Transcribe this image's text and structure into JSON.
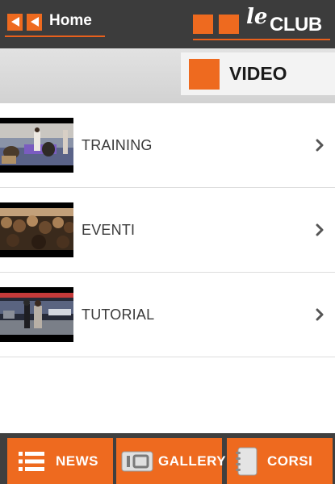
{
  "header": {
    "back_label": "Home",
    "back_icon": "double-left-arrow-icon",
    "logo_text_le": "le",
    "logo_text_club": "CLUB"
  },
  "section": {
    "title": "VIDEO"
  },
  "list": {
    "items": [
      {
        "label": "TRAINING",
        "thumbnail": "training-video-thumbnail"
      },
      {
        "label": "EVENTI",
        "thumbnail": "eventi-video-thumbnail"
      },
      {
        "label": "TUTORIAL",
        "thumbnail": "tutorial-video-thumbnail"
      }
    ]
  },
  "tabbar": {
    "tabs": [
      {
        "label": "NEWS",
        "icon": "list-icon"
      },
      {
        "label": "GALLERY",
        "icon": "camera-icon"
      },
      {
        "label": "CORSI",
        "icon": "notebook-icon"
      }
    ]
  },
  "colors": {
    "accent": "#ee6a1f",
    "topbar": "#3c3c3c",
    "tabbar": "#3f3f3f"
  }
}
